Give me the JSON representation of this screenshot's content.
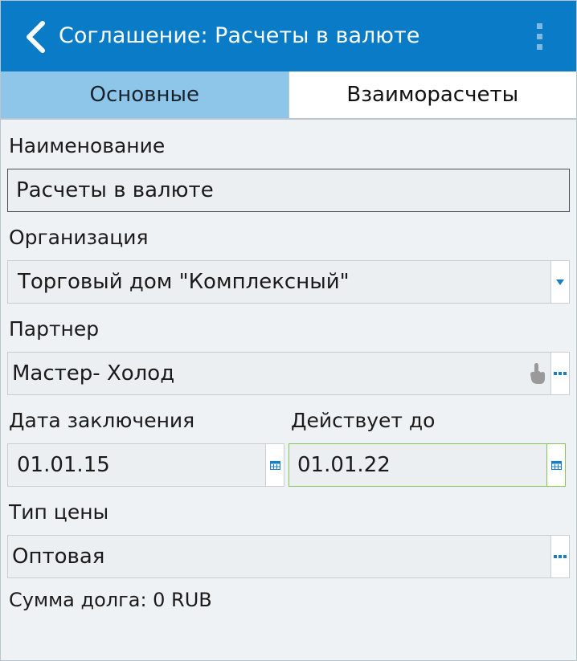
{
  "header": {
    "title": "Соглашение: Расчеты в валюте"
  },
  "tabs": [
    {
      "label": "Основные",
      "active": true
    },
    {
      "label": "Взаиморасчеты",
      "active": false
    }
  ],
  "form": {
    "name": {
      "label": "Наименование",
      "value": "Расчеты в валюте"
    },
    "organization": {
      "label": "Организация",
      "value": "Торговый дом \"Комплексный\""
    },
    "partner": {
      "label": "Партнер",
      "value": "Мастер- Холод"
    },
    "date_start": {
      "label": "Дата заключения",
      "value": "01.01.15"
    },
    "date_end": {
      "label": "Действует до",
      "value": "01.01.22"
    },
    "price_type": {
      "label": "Тип цены",
      "value": "Оптовая"
    }
  },
  "footer": {
    "debt": "Сумма долга: 0 RUB"
  },
  "colors": {
    "accent": "#0a7cc7",
    "tab_active": "#8ec6ea",
    "focus_green": "#86c45a"
  }
}
